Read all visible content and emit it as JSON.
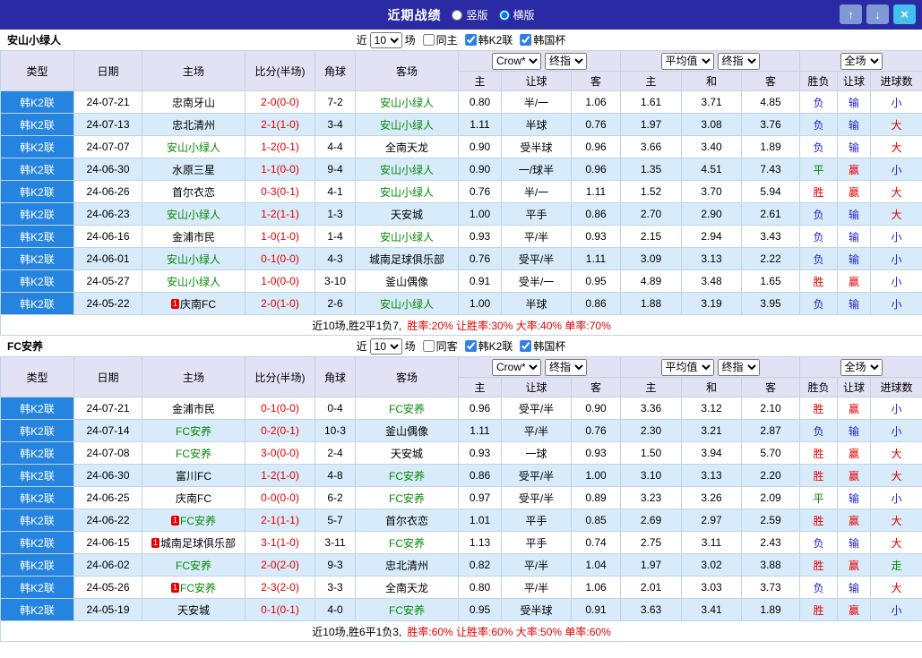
{
  "titlebar": {
    "title": "近期战绩",
    "layout_options": [
      {
        "label": "竖版",
        "selected": false
      },
      {
        "label": "横版",
        "selected": true
      }
    ],
    "buttons": {
      "up": "↑",
      "down": "↓",
      "close": "×"
    }
  },
  "colors": {
    "titlebar_bg": "#2a2aa4",
    "btn_updown": "#7e99d4",
    "btn_close": "#43bfee",
    "type_bg": "#2584e0",
    "header_bg": "#e2e2f4",
    "row_alt_bg": "#d7ebfa",
    "border": "#c0d4e6",
    "red": "#e60000",
    "blue": "#2323cc",
    "green": "#078a07",
    "result_map": {
      "胜": "red",
      "负": "blue",
      "平": "green",
      "赢": "red",
      "输": "blue",
      "大": "red",
      "小": "blue",
      "走": "green"
    }
  },
  "table_header": {
    "type": "类型",
    "date": "日期",
    "home": "主场",
    "score": "比分(半场)",
    "corner": "角球",
    "away": "客场",
    "odds_source": "Crow*",
    "odds_final1": "终指",
    "avg": "平均值",
    "odds_final2": "终指",
    "scope": "全场",
    "sub": [
      "主",
      "让球",
      "客",
      "主",
      "和",
      "客",
      "胜负",
      "让球",
      "进球数"
    ]
  },
  "sections": [
    {
      "team": "安山小绿人",
      "filters": {
        "near": "近",
        "count": "10",
        "games": "场",
        "same": "同主",
        "same_checked": false,
        "league": "韩K2联",
        "league_checked": true,
        "cup": "韩国杯",
        "cup_checked": true
      },
      "rows": [
        {
          "league": "韩K2联",
          "date": "24-07-21",
          "home": "忠南牙山",
          "home_focus": false,
          "home_rank": "",
          "score": "2-0(0-0)",
          "corner": "7-2",
          "away": "安山小绿人",
          "away_focus": true,
          "away_rank": "",
          "odds": [
            "0.80",
            "半/一",
            "1.06",
            "1.61",
            "3.71",
            "4.85"
          ],
          "results": [
            "负",
            "输",
            "小"
          ]
        },
        {
          "league": "韩K2联",
          "date": "24-07-13",
          "home": "忠北清州",
          "home_focus": false,
          "home_rank": "",
          "score": "2-1(1-0)",
          "corner": "3-4",
          "away": "安山小绿人",
          "away_focus": true,
          "away_rank": "",
          "odds": [
            "1.11",
            "半球",
            "0.76",
            "1.97",
            "3.08",
            "3.76"
          ],
          "results": [
            "负",
            "输",
            "大"
          ]
        },
        {
          "league": "韩K2联",
          "date": "24-07-07",
          "home": "安山小绿人",
          "home_focus": true,
          "home_rank": "",
          "score": "1-2(0-1)",
          "corner": "4-4",
          "away": "全南天龙",
          "away_focus": false,
          "away_rank": "",
          "odds": [
            "0.90",
            "受半球",
            "0.96",
            "3.66",
            "3.40",
            "1.89"
          ],
          "results": [
            "负",
            "输",
            "大"
          ]
        },
        {
          "league": "韩K2联",
          "date": "24-06-30",
          "home": "水原三星",
          "home_focus": false,
          "home_rank": "",
          "score": "1-1(0-0)",
          "corner": "9-4",
          "away": "安山小绿人",
          "away_focus": true,
          "away_rank": "",
          "odds": [
            "0.90",
            "一/球半",
            "0.96",
            "1.35",
            "4.51",
            "7.43"
          ],
          "results": [
            "平",
            "赢",
            "小"
          ]
        },
        {
          "league": "韩K2联",
          "date": "24-06-26",
          "home": "首尔衣恋",
          "home_focus": false,
          "home_rank": "",
          "score": "0-3(0-1)",
          "corner": "4-1",
          "away": "安山小绿人",
          "away_focus": true,
          "away_rank": "",
          "odds": [
            "0.76",
            "半/一",
            "1.11",
            "1.52",
            "3.70",
            "5.94"
          ],
          "results": [
            "胜",
            "赢",
            "大"
          ]
        },
        {
          "league": "韩K2联",
          "date": "24-06-23",
          "home": "安山小绿人",
          "home_focus": true,
          "home_rank": "",
          "score": "1-2(1-1)",
          "corner": "1-3",
          "away": "天安城",
          "away_focus": false,
          "away_rank": "",
          "odds": [
            "1.00",
            "平手",
            "0.86",
            "2.70",
            "2.90",
            "2.61"
          ],
          "results": [
            "负",
            "输",
            "大"
          ]
        },
        {
          "league": "韩K2联",
          "date": "24-06-16",
          "home": "金浦市民",
          "home_focus": false,
          "home_rank": "",
          "score": "1-0(1-0)",
          "corner": "1-4",
          "away": "安山小绿人",
          "away_focus": true,
          "away_rank": "",
          "odds": [
            "0.93",
            "平/半",
            "0.93",
            "2.15",
            "2.94",
            "3.43"
          ],
          "results": [
            "负",
            "输",
            "小"
          ]
        },
        {
          "league": "韩K2联",
          "date": "24-06-01",
          "home": "安山小绿人",
          "home_focus": true,
          "home_rank": "",
          "score": "0-1(0-0)",
          "corner": "4-3",
          "away": "城南足球俱乐部",
          "away_focus": false,
          "away_rank": "",
          "odds": [
            "0.76",
            "受平/半",
            "1.11",
            "3.09",
            "3.13",
            "2.22"
          ],
          "results": [
            "负",
            "输",
            "小"
          ]
        },
        {
          "league": "韩K2联",
          "date": "24-05-27",
          "home": "安山小绿人",
          "home_focus": true,
          "home_rank": "",
          "score": "1-0(0-0)",
          "corner": "3-10",
          "away": "釜山偶像",
          "away_focus": false,
          "away_rank": "",
          "odds": [
            "0.91",
            "受半/一",
            "0.95",
            "4.89",
            "3.48",
            "1.65"
          ],
          "results": [
            "胜",
            "赢",
            "小"
          ]
        },
        {
          "league": "韩K2联",
          "date": "24-05-22",
          "home": "庆南FC",
          "home_focus": false,
          "home_rank": "1",
          "score": "2-0(1-0)",
          "corner": "2-6",
          "away": "安山小绿人",
          "away_focus": true,
          "away_rank": "",
          "odds": [
            "1.00",
            "半球",
            "0.86",
            "1.88",
            "3.19",
            "3.95"
          ],
          "results": [
            "负",
            "输",
            "小"
          ]
        }
      ],
      "summary": {
        "plain": "近10场,胜2平1负7,",
        "highlight": "胜率:20% 让胜率:30% 大率:40% 单率:70%"
      }
    },
    {
      "team": "FC安养",
      "filters": {
        "near": "近",
        "count": "10",
        "games": "场",
        "same": "同客",
        "same_checked": false,
        "league": "韩K2联",
        "league_checked": true,
        "cup": "韩国杯",
        "cup_checked": true
      },
      "rows": [
        {
          "league": "韩K2联",
          "date": "24-07-21",
          "home": "金浦市民",
          "home_focus": false,
          "home_rank": "",
          "score": "0-1(0-0)",
          "corner": "0-4",
          "away": "FC安养",
          "away_focus": true,
          "away_rank": "",
          "odds": [
            "0.96",
            "受平/半",
            "0.90",
            "3.36",
            "3.12",
            "2.10"
          ],
          "results": [
            "胜",
            "赢",
            "小"
          ]
        },
        {
          "league": "韩K2联",
          "date": "24-07-14",
          "home": "FC安养",
          "home_focus": true,
          "home_rank": "",
          "score": "0-2(0-1)",
          "corner": "10-3",
          "away": "釜山偶像",
          "away_focus": false,
          "away_rank": "",
          "odds": [
            "1.11",
            "平/半",
            "0.76",
            "2.30",
            "3.21",
            "2.87"
          ],
          "results": [
            "负",
            "输",
            "小"
          ]
        },
        {
          "league": "韩K2联",
          "date": "24-07-08",
          "home": "FC安养",
          "home_focus": true,
          "home_rank": "",
          "score": "3-0(0-0)",
          "corner": "2-4",
          "away": "天安城",
          "away_focus": false,
          "away_rank": "",
          "odds": [
            "0.93",
            "一球",
            "0.93",
            "1.50",
            "3.94",
            "5.70"
          ],
          "results": [
            "胜",
            "赢",
            "大"
          ]
        },
        {
          "league": "韩K2联",
          "date": "24-06-30",
          "home": "富川FC",
          "home_focus": false,
          "home_rank": "",
          "score": "1-2(1-0)",
          "corner": "4-8",
          "away": "FC安养",
          "away_focus": true,
          "away_rank": "",
          "odds": [
            "0.86",
            "受平/半",
            "1.00",
            "3.10",
            "3.13",
            "2.20"
          ],
          "results": [
            "胜",
            "赢",
            "大"
          ]
        },
        {
          "league": "韩K2联",
          "date": "24-06-25",
          "home": "庆南FC",
          "home_focus": false,
          "home_rank": "",
          "score": "0-0(0-0)",
          "corner": "6-2",
          "away": "FC安养",
          "away_focus": true,
          "away_rank": "",
          "odds": [
            "0.97",
            "受平/半",
            "0.89",
            "3.23",
            "3.26",
            "2.09"
          ],
          "results": [
            "平",
            "输",
            "小"
          ]
        },
        {
          "league": "韩K2联",
          "date": "24-06-22",
          "home": "FC安养",
          "home_focus": true,
          "home_rank": "1",
          "score": "2-1(1-1)",
          "corner": "5-7",
          "away": "首尔衣恋",
          "away_focus": false,
          "away_rank": "",
          "odds": [
            "1.01",
            "平手",
            "0.85",
            "2.69",
            "2.97",
            "2.59"
          ],
          "results": [
            "胜",
            "赢",
            "大"
          ]
        },
        {
          "league": "韩K2联",
          "date": "24-06-15",
          "home": "城南足球俱乐部",
          "home_focus": false,
          "home_rank": "1",
          "score": "3-1(1-0)",
          "corner": "3-11",
          "away": "FC安养",
          "away_focus": true,
          "away_rank": "",
          "odds": [
            "1.13",
            "平手",
            "0.74",
            "2.75",
            "3.11",
            "2.43"
          ],
          "results": [
            "负",
            "输",
            "大"
          ]
        },
        {
          "league": "韩K2联",
          "date": "24-06-02",
          "home": "FC安养",
          "home_focus": true,
          "home_rank": "",
          "score": "2-0(2-0)",
          "corner": "9-3",
          "away": "忠北清州",
          "away_focus": false,
          "away_rank": "",
          "odds": [
            "0.82",
            "平/半",
            "1.04",
            "1.97",
            "3.02",
            "3.88"
          ],
          "results": [
            "胜",
            "赢",
            "走"
          ]
        },
        {
          "league": "韩K2联",
          "date": "24-05-26",
          "home": "FC安养",
          "home_focus": true,
          "home_rank": "1",
          "score": "2-3(2-0)",
          "corner": "3-3",
          "away": "全南天龙",
          "away_focus": false,
          "away_rank": "",
          "odds": [
            "0.80",
            "平/半",
            "1.06",
            "2.01",
            "3.03",
            "3.73"
          ],
          "results": [
            "负",
            "输",
            "大"
          ]
        },
        {
          "league": "韩K2联",
          "date": "24-05-19",
          "home": "天安城",
          "home_focus": false,
          "home_rank": "",
          "score": "0-1(0-1)",
          "corner": "4-0",
          "away": "FC安养",
          "away_focus": true,
          "away_rank": "",
          "odds": [
            "0.95",
            "受半球",
            "0.91",
            "3.63",
            "3.41",
            "1.89"
          ],
          "results": [
            "胜",
            "赢",
            "小"
          ]
        }
      ],
      "summary": {
        "plain": "近10场,胜6平1负3,",
        "highlight": "胜率:60% 让胜率:60% 大率:50% 单率:60%"
      }
    }
  ]
}
